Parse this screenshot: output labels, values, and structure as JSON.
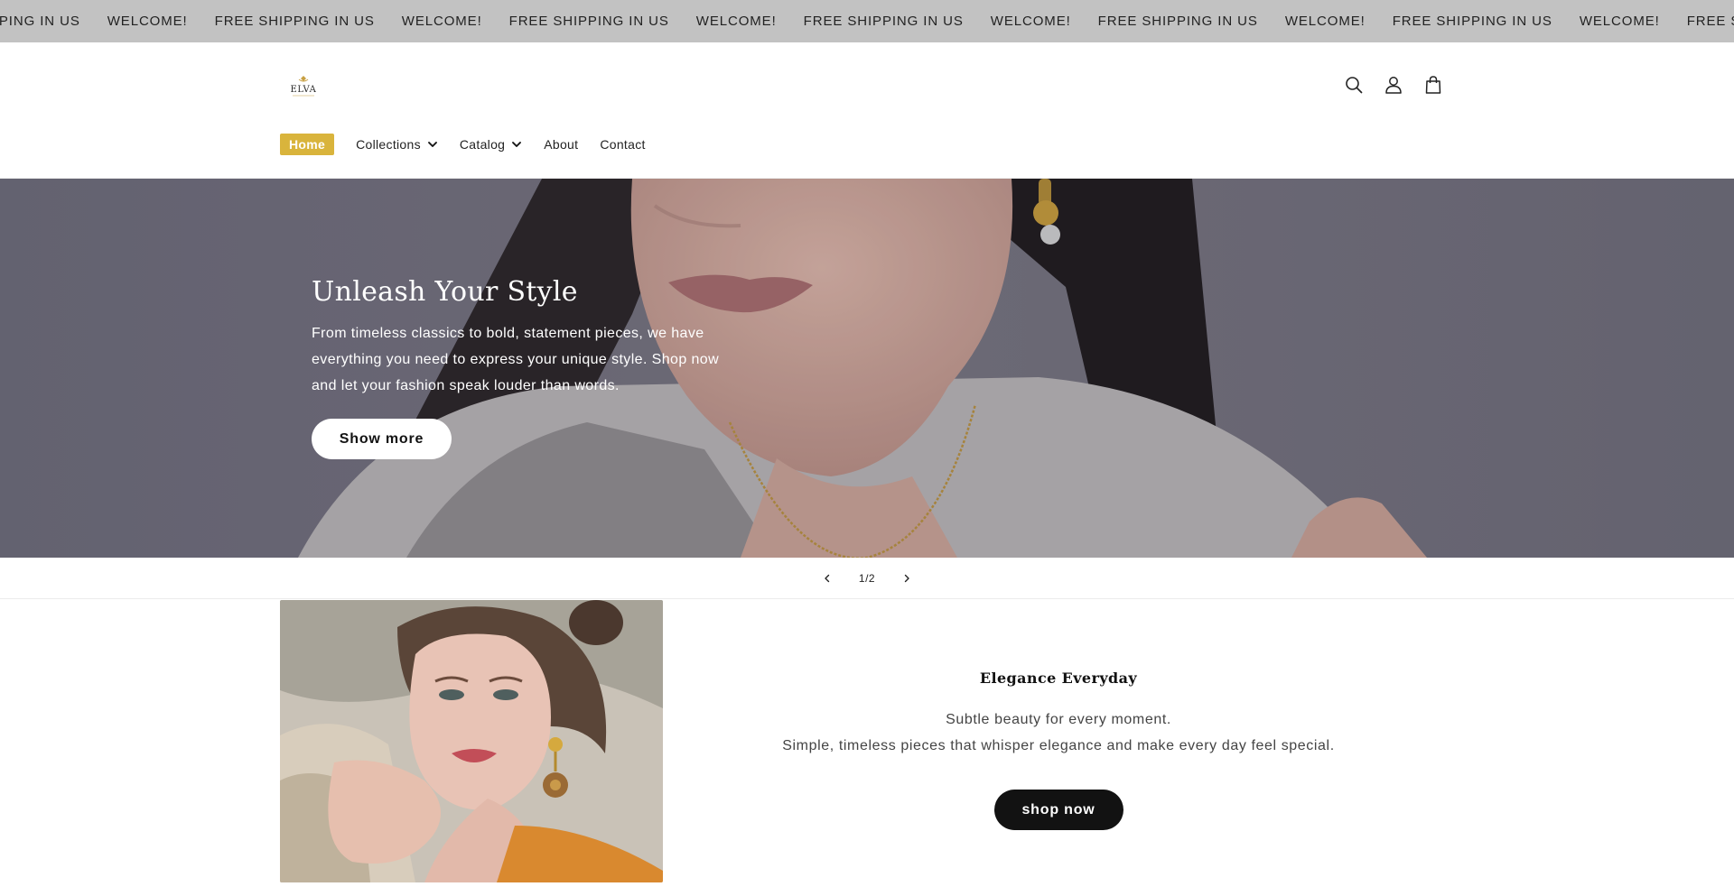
{
  "announcement": {
    "items": [
      "PPING IN US",
      "WELCOME!",
      "FREE SHIPPING IN US",
      "WELCOME!",
      "FREE SHIPPING IN US",
      "WELCOME!",
      "FREE SHIPPING IN US",
      "WELCOME!",
      "FREE SHIPPING IN US",
      "WELCOME!",
      "FREE SHIPPING IN US",
      "WELCOME!",
      "FREE SHIPP"
    ],
    "background": "#c2c2c2"
  },
  "header": {
    "logo_text": "ELVA",
    "icons": [
      "search-icon",
      "account-icon",
      "cart-icon"
    ],
    "nav": [
      {
        "label": "Home",
        "active": true
      },
      {
        "label": "Collections",
        "dropdown": true
      },
      {
        "label": "Catalog",
        "dropdown": true
      },
      {
        "label": "About"
      },
      {
        "label": "Contact"
      }
    ],
    "active_color": "#d9b43c"
  },
  "hero": {
    "title": "Unleash Your Style",
    "text": "From timeless classics to bold, statement pieces, we have everything you need to express your unique style. Shop now and let your fashion speak louder than words.",
    "button": "Show more",
    "counter": "1/2"
  },
  "feature": {
    "title": "Elegance Everyday",
    "line1": "Subtle beauty for every moment.",
    "line2": "Simple, timeless pieces that whisper elegance and make every day feel special.",
    "button": "shop now"
  }
}
